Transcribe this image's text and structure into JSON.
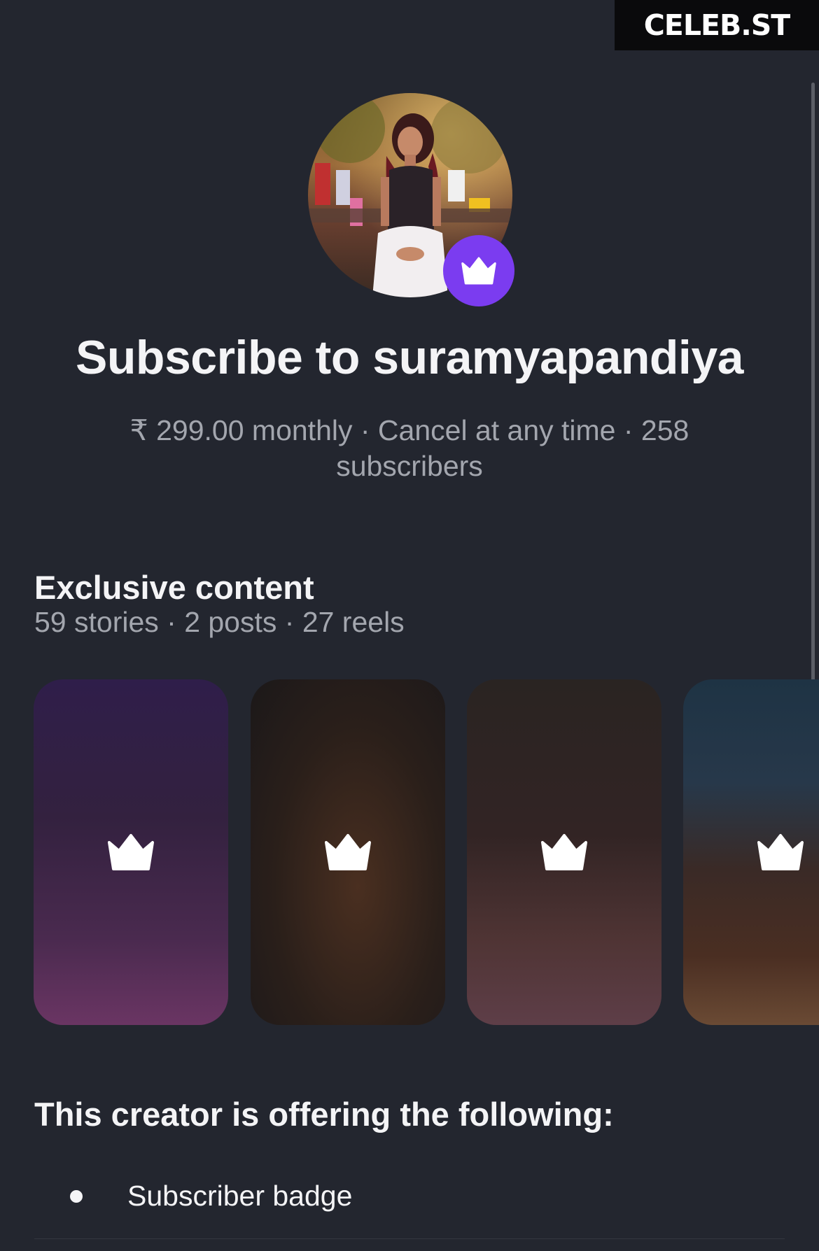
{
  "watermark": {
    "text": "CELEB.ST"
  },
  "profile": {
    "avatar_alt": "profile photo",
    "badge_icon": "crown-icon",
    "badge_color": "#7b3cf0"
  },
  "header": {
    "title": "Subscribe to suramyapandiya",
    "subtitle": "₹ 299.00 monthly · Cancel at any time · 258 subscribers"
  },
  "exclusive": {
    "title": "Exclusive content",
    "meta": "59 stories · 2 posts · 27 reels",
    "cards": [
      {
        "icon": "crown-icon"
      },
      {
        "icon": "crown-icon"
      },
      {
        "icon": "crown-icon"
      },
      {
        "icon": "crown-icon"
      }
    ]
  },
  "offering": {
    "title": "This creator is offering the following:",
    "items": [
      "Subscriber badge"
    ]
  },
  "colors": {
    "background": "#23262f",
    "text_primary": "#f4f4f6",
    "text_secondary": "#a3a6ae",
    "accent": "#7b3cf0"
  }
}
